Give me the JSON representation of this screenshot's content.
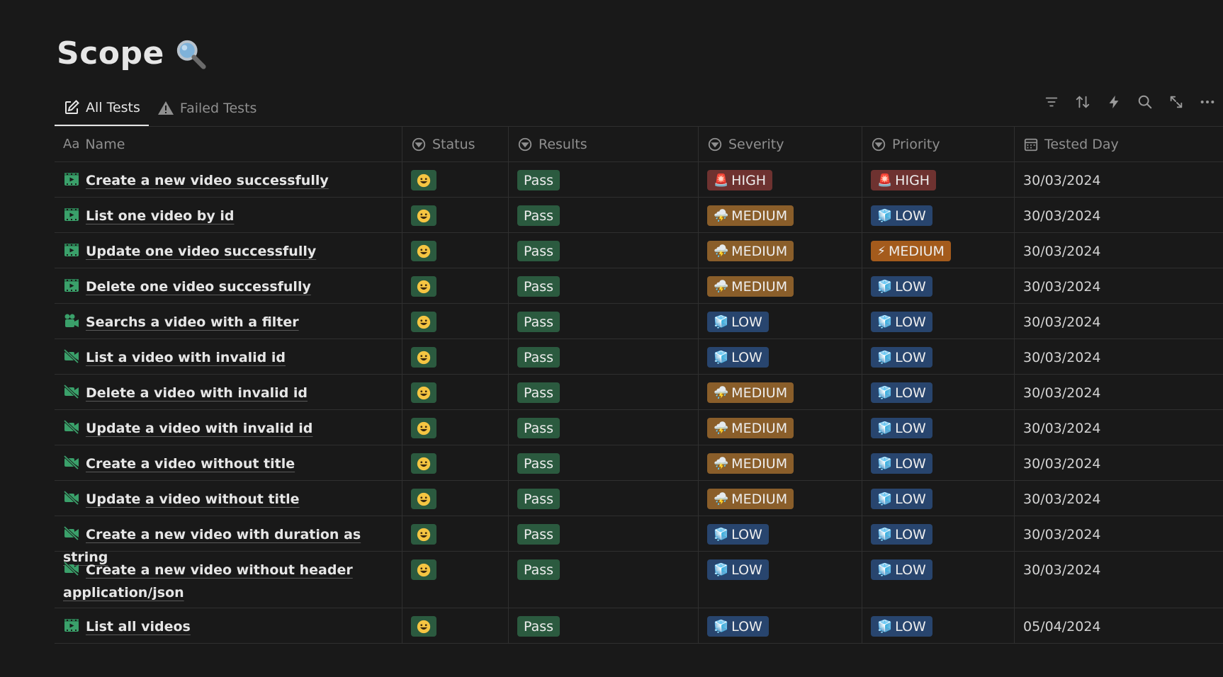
{
  "page": {
    "title": "Scope",
    "title_icon": "magnifier-icon"
  },
  "tabs": [
    {
      "label": "All Tests",
      "icon": "edit-icon",
      "active": true
    },
    {
      "label": "Failed Tests",
      "icon": "warning-icon",
      "active": false
    }
  ],
  "toolbar": [
    "filter-icon",
    "sort-icon",
    "lightning-icon",
    "search-icon",
    "expand-icon",
    "more-icon"
  ],
  "columns": {
    "name_prefix": "Aa",
    "name": "Name",
    "status": "Status",
    "results": "Results",
    "severity": "Severity",
    "priority": "Priority",
    "tested_day": "Tested Day"
  },
  "colors": {
    "pass": "#2b5a3f",
    "high": "#6e3230",
    "medium": "#8a5e2a",
    "low": "#28456e",
    "priority_medium": "#a45b1c"
  },
  "rows": [
    {
      "name": "Create a new video successfully",
      "icon": "clapper-icon",
      "status": "😃",
      "result": "Pass",
      "severity": "HIGH",
      "severity_emoji": "🚨",
      "priority": "HIGH",
      "priority_emoji": "🚨",
      "day": "30/03/2024"
    },
    {
      "name": "List one video by id",
      "icon": "clapper-icon",
      "status": "😃",
      "result": "Pass",
      "severity": "MEDIUM",
      "severity_emoji": "⛈️",
      "priority": "LOW",
      "priority_emoji": "🧊",
      "day": "30/03/2024"
    },
    {
      "name": "Update one video successfully",
      "icon": "clapper-icon",
      "status": "😃",
      "result": "Pass",
      "severity": "MEDIUM",
      "severity_emoji": "⛈️",
      "priority": "MEDIUM",
      "priority_emoji": "⚡",
      "day": "30/03/2024"
    },
    {
      "name": "Delete one video successfully",
      "icon": "clapper-icon",
      "status": "😃",
      "result": "Pass",
      "severity": "MEDIUM",
      "severity_emoji": "⛈️",
      "priority": "LOW",
      "priority_emoji": "🧊",
      "day": "30/03/2024"
    },
    {
      "name": "Searchs a video with a filter",
      "icon": "camera-icon",
      "status": "😃",
      "result": "Pass",
      "severity": "LOW",
      "severity_emoji": "🧊",
      "priority": "LOW",
      "priority_emoji": "🧊",
      "day": "30/03/2024"
    },
    {
      "name": "List a video with invalid id",
      "icon": "video-off-icon",
      "status": "😃",
      "result": "Pass",
      "severity": "LOW",
      "severity_emoji": "🧊",
      "priority": "LOW",
      "priority_emoji": "🧊",
      "day": "30/03/2024"
    },
    {
      "name": "Delete a video with invalid id",
      "icon": "video-off-icon",
      "status": "😃",
      "result": "Pass",
      "severity": "MEDIUM",
      "severity_emoji": "⛈️",
      "priority": "LOW",
      "priority_emoji": "🧊",
      "day": "30/03/2024"
    },
    {
      "name": "Update a video with invalid id",
      "icon": "video-off-icon",
      "status": "😃",
      "result": "Pass",
      "severity": "MEDIUM",
      "severity_emoji": "⛈️",
      "priority": "LOW",
      "priority_emoji": "🧊",
      "day": "30/03/2024"
    },
    {
      "name": "Create a video without title",
      "icon": "video-off-icon",
      "status": "😃",
      "result": "Pass",
      "severity": "MEDIUM",
      "severity_emoji": "⛈️",
      "priority": "LOW",
      "priority_emoji": "🧊",
      "day": "30/03/2024"
    },
    {
      "name": "Update a video without title",
      "icon": "video-off-icon",
      "status": "😃",
      "result": "Pass",
      "severity": "MEDIUM",
      "severity_emoji": "⛈️",
      "priority": "LOW",
      "priority_emoji": "🧊",
      "day": "30/03/2024"
    },
    {
      "name": "Create a new video with duration as string",
      "icon": "video-off-icon",
      "status": "😃",
      "result": "Pass",
      "severity": "LOW",
      "severity_emoji": "🧊",
      "priority": "LOW",
      "priority_emoji": "🧊",
      "day": "30/03/2024"
    },
    {
      "name": "Create a new video without header application/json",
      "icon": "video-off-icon",
      "status": "😃",
      "result": "Pass",
      "severity": "LOW",
      "severity_emoji": "🧊",
      "priority": "LOW",
      "priority_emoji": "🧊",
      "day": "30/03/2024"
    },
    {
      "name": "List all videos",
      "icon": "clapper-icon",
      "status": "😃",
      "result": "Pass",
      "severity": "LOW",
      "severity_emoji": "🧊",
      "priority": "LOW",
      "priority_emoji": "🧊",
      "day": "05/04/2024"
    }
  ]
}
